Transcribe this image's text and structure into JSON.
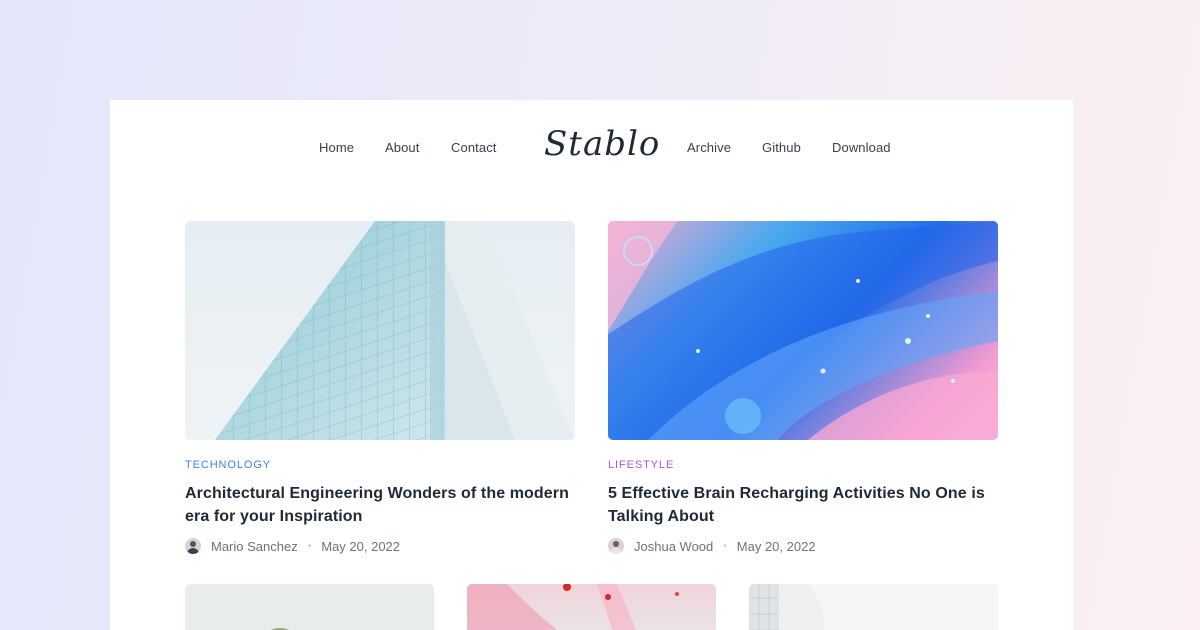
{
  "nav": {
    "left": [
      "Home",
      "About",
      "Contact"
    ],
    "logo": "Stablo",
    "right": [
      "Archive",
      "Github",
      "Download"
    ]
  },
  "posts": [
    {
      "category": "Technology",
      "category_color": "#3b82f6",
      "title": "Architectural Engineering Wonders of the modern era for your Inspiration",
      "author": "Mario Sanchez",
      "date": "May 20, 2022"
    },
    {
      "category": "Lifestyle",
      "category_color": "#a855f7",
      "title": "5 Effective Brain Recharging Activities No One is Talking About",
      "author": "Joshua Wood",
      "date": "May 20, 2022"
    }
  ]
}
